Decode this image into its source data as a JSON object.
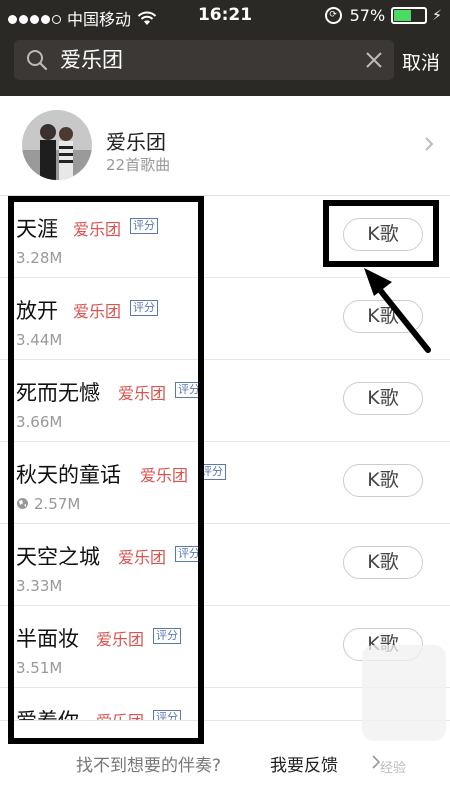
{
  "status_bar": {
    "carrier": "中国移动",
    "time": "16:21",
    "battery_percent": "57%",
    "battery_level": 0.57,
    "signal_dots": 4
  },
  "search": {
    "query": "爱乐团",
    "cancel_label": "取消"
  },
  "artist": {
    "name": "爱乐团",
    "song_count": "22首歌曲"
  },
  "songs": [
    {
      "title": "天涯",
      "artist": "爱乐团",
      "badge": "评分",
      "size": "3.28M",
      "button": "K歌"
    },
    {
      "title": "放开",
      "artist": "爱乐团",
      "badge": "评分",
      "size": "3.44M",
      "button": "K歌"
    },
    {
      "title": "死而无憾",
      "artist": "爱乐团",
      "badge": "评分",
      "size": "3.66M",
      "button": "K歌"
    },
    {
      "title": "秋天的童话",
      "artist": "爱乐团",
      "badge": "评分",
      "size": "2.57M",
      "button": "K歌"
    },
    {
      "title": "天空之城",
      "artist": "爱乐团",
      "badge": "评分",
      "size": "3.33M",
      "button": "K歌"
    },
    {
      "title": "半面妆",
      "artist": "爱乐团",
      "badge": "评分",
      "size": "3.51M",
      "button": "K歌"
    },
    {
      "title": "爱着你",
      "artist": "爱乐团",
      "badge": "评分",
      "size": "",
      "button": ""
    }
  ],
  "footer": {
    "hint": "找不到想要的伴奏?",
    "feedback": "我要反馈"
  },
  "watermark": "经验",
  "colors": {
    "header_bg": "#2b2926",
    "artist_red": "#d9534f",
    "badge_blue": "#5a78b0",
    "battery_green": "#4cd964"
  }
}
